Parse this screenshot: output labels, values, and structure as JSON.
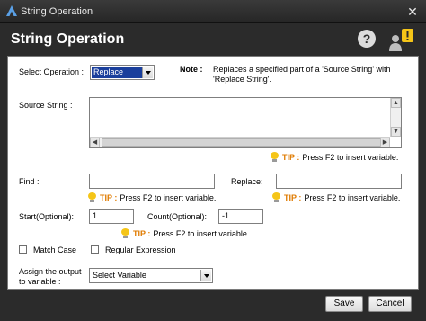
{
  "window": {
    "title": "String Operation",
    "app_icon": "app-logo-icon",
    "close_icon": "close-icon"
  },
  "header": {
    "heading": "String Operation",
    "help_icon": "help-icon",
    "user_alert_icon": "user-alert-icon"
  },
  "form": {
    "select_operation": {
      "label": "Select Operation :",
      "value": "Replace"
    },
    "note": {
      "label": "Note :",
      "text_line1": "Replaces a specified part of a 'Source String' with",
      "text_line2": "'Replace String'."
    },
    "source_string": {
      "label": "Source String :",
      "value": ""
    },
    "tip": {
      "word": "TIP :",
      "text": "Press F2 to insert variable."
    },
    "find": {
      "label": "Find :",
      "value": ""
    },
    "replace": {
      "label": "Replace:",
      "value": ""
    },
    "start": {
      "label": "Start(Optional):",
      "value": "1"
    },
    "count": {
      "label": "Count(Optional):",
      "value": "-1"
    },
    "match_case": {
      "label": "Match Case",
      "checked": false
    },
    "regex": {
      "label": "Regular Expression",
      "checked": false
    },
    "assign_output": {
      "label_line1": "Assign the output",
      "label_line2": "to variable :",
      "value": "Select Variable"
    }
  },
  "footer": {
    "save_label": "Save",
    "cancel_label": "Cancel"
  },
  "colors": {
    "title_bar": "#2b2b2b",
    "tip_accent": "#e07b00",
    "bulb": "#f5c518",
    "selected_option": "#1a3f9c"
  }
}
